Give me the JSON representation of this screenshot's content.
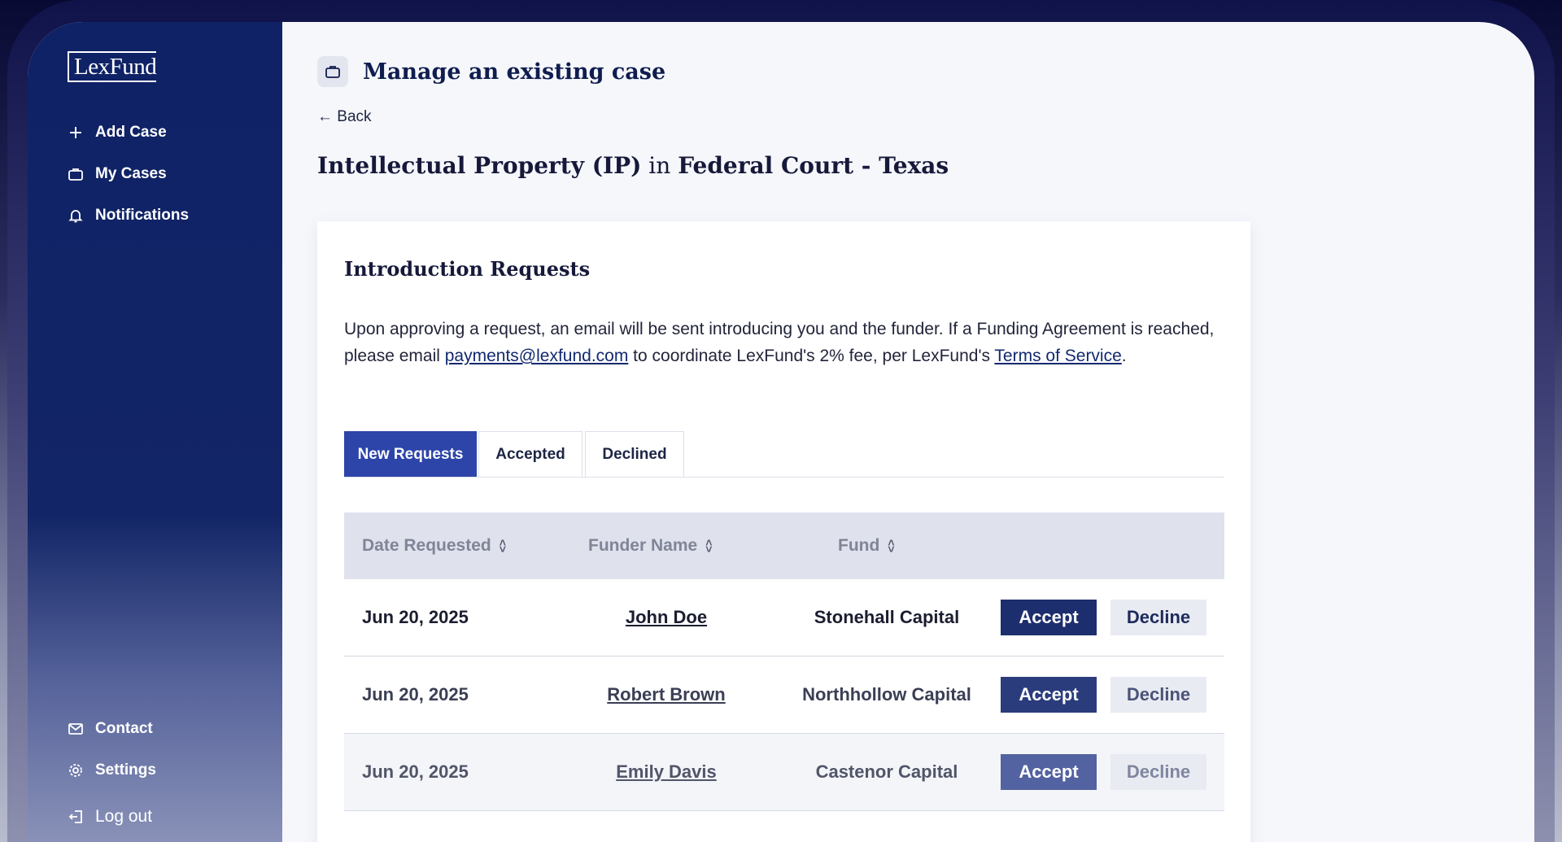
{
  "app": {
    "logo_text": "LexFund"
  },
  "sidebar": {
    "items": [
      {
        "label": "Add Case",
        "icon": "plus-icon"
      },
      {
        "label": "My Cases",
        "icon": "briefcase-icon"
      },
      {
        "label": "Notifications",
        "icon": "bell-icon"
      }
    ],
    "bottom_items": [
      {
        "label": "Contact",
        "icon": "mail-icon"
      },
      {
        "label": "Settings",
        "icon": "gear-icon"
      },
      {
        "label": "Log out",
        "icon": "logout-icon"
      }
    ]
  },
  "header": {
    "title": "Manage an existing case",
    "back_label": "← Back",
    "case_type": "Intellectual Property (IP)",
    "case_connector": " in ",
    "case_court": "Federal Court - Texas"
  },
  "requests": {
    "title": "Introduction Requests",
    "description_pre": "Upon approving a request, an email will be sent introducing you and the funder. If a Funding Agreement is reached, please email ",
    "email_link": "payments@lexfund.com",
    "description_mid": " to coordinate LexFund's 2% fee, per LexFund's ",
    "terms_link": "Terms of Service",
    "description_post": ".",
    "tabs": [
      {
        "label": "New Requests",
        "active": true
      },
      {
        "label": "Accepted",
        "active": false
      },
      {
        "label": "Declined",
        "active": false
      }
    ],
    "columns": [
      "Date Requested",
      "Funder Name",
      "Fund"
    ],
    "rows": [
      {
        "date": "Jun 20, 2025",
        "funder": "John Doe",
        "fund": "Stonehall Capital",
        "accept": "Accept",
        "decline": "Decline"
      },
      {
        "date": "Jun 20, 2025",
        "funder": "Robert Brown",
        "fund": "Northhollow Capital",
        "accept": "Accept",
        "decline": "Decline"
      },
      {
        "date": "Jun 20, 2025",
        "funder": "Emily Davis",
        "fund": "Castenor Capital",
        "accept": "Accept",
        "decline": "Decline"
      }
    ]
  },
  "colors": {
    "primary": "#2d45a8",
    "sidebar": "#0f2266",
    "accept": "#1d2e6e"
  }
}
